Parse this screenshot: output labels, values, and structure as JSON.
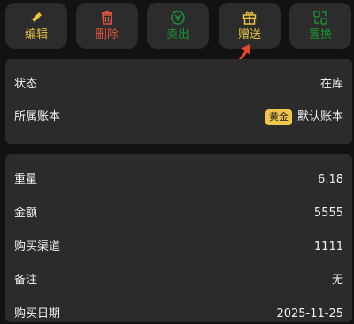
{
  "toolbar": {
    "buttons": [
      {
        "label": "编辑",
        "icon": "pencil-icon",
        "color": "#e8c43f"
      },
      {
        "label": "删除",
        "icon": "trash-icon",
        "color": "#e0533d"
      },
      {
        "label": "卖出",
        "icon": "coin-icon",
        "color": "#1d8f34"
      },
      {
        "label": "赠送",
        "icon": "gift-icon",
        "color": "#e8c43f"
      },
      {
        "label": "置换",
        "icon": "swap-icon",
        "color": "#1d8f34"
      }
    ]
  },
  "status_card": {
    "status_label": "状态",
    "status_value": "在库",
    "account_label": "所属账本",
    "account_badge": "黄金",
    "account_value": "默认账本"
  },
  "detail_card": {
    "weight_label": "重量",
    "weight_value": "6.18",
    "amount_label": "金额",
    "amount_value": "5555",
    "channel_label": "购买渠道",
    "channel_value": "1111",
    "note_label": "备注",
    "note_value": "无",
    "date_label": "购买日期",
    "date_value": "2025-11-25"
  },
  "colors": {
    "background": "#121212",
    "card": "#2b2b2b",
    "badge": "#f0c64a",
    "arrow": "#e8452c"
  }
}
